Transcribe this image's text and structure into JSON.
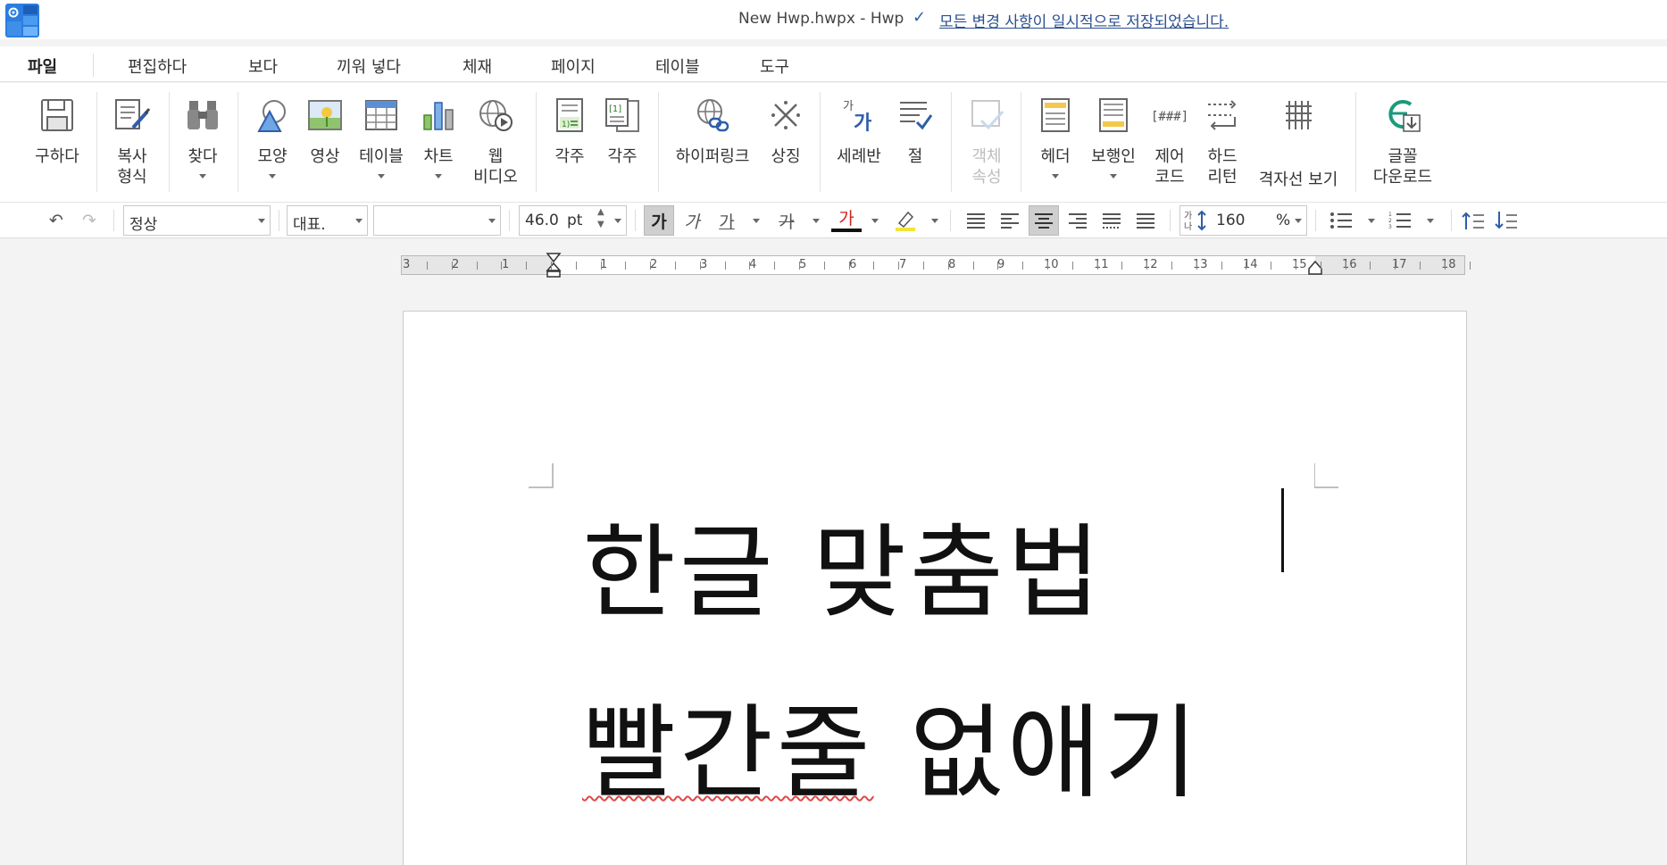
{
  "titlebar": {
    "doc_title": "New Hwp.hwpx - Hwp",
    "save_status": "모든 변경 사항이 일시적으로 저장되었습니다."
  },
  "menu": {
    "items": [
      "파일",
      "편집하다",
      "보다",
      "끼워 넣다",
      "체재",
      "페이지",
      "테이블",
      "도구"
    ],
    "active": "파일"
  },
  "ribbon": {
    "save": "구하다",
    "copy_format": "복사\n형식",
    "find": "찾다",
    "shape": "모양",
    "image": "영상",
    "table": "테이블",
    "chart": "차트",
    "web_video": "웹\n비디오",
    "footnote": "각주",
    "endnote": "각주",
    "hyperlink": "하이퍼링크",
    "symbol": "상징",
    "ruby": "세례반",
    "section": "절",
    "object_props": "객체\n속성",
    "header": "헤더",
    "footer": "보행인",
    "control_code": "제어\n코드",
    "hard_return": "하드\n리턴",
    "grid_view": "격자선 보기",
    "font_download": "글꼴\n다운로드"
  },
  "format": {
    "style": "정상",
    "font_group": "대표.",
    "font_name": "",
    "font_size": "46.0",
    "font_unit": "pt",
    "bold_glyph": "가",
    "italic_glyph": "가",
    "underline_glyph": "가",
    "strike_glyph": "가",
    "color_glyph": "가",
    "line_spacing": "160",
    "line_spacing_unit": "%",
    "colors": {
      "font_color": "#d32020",
      "highlight": "#f3e33a",
      "accent": "#2f5ea8"
    }
  },
  "ruler": {
    "numbers": [
      "3",
      "2",
      "1",
      "1",
      "2",
      "3",
      "4",
      "5",
      "6",
      "7",
      "8",
      "9",
      "10",
      "11",
      "12",
      "13",
      "14",
      "15",
      "16",
      "17",
      "18"
    ]
  },
  "document": {
    "line1": "한글 맞춤법",
    "line2": "빨간줄 없애기",
    "misspelled": "빨간줄"
  }
}
